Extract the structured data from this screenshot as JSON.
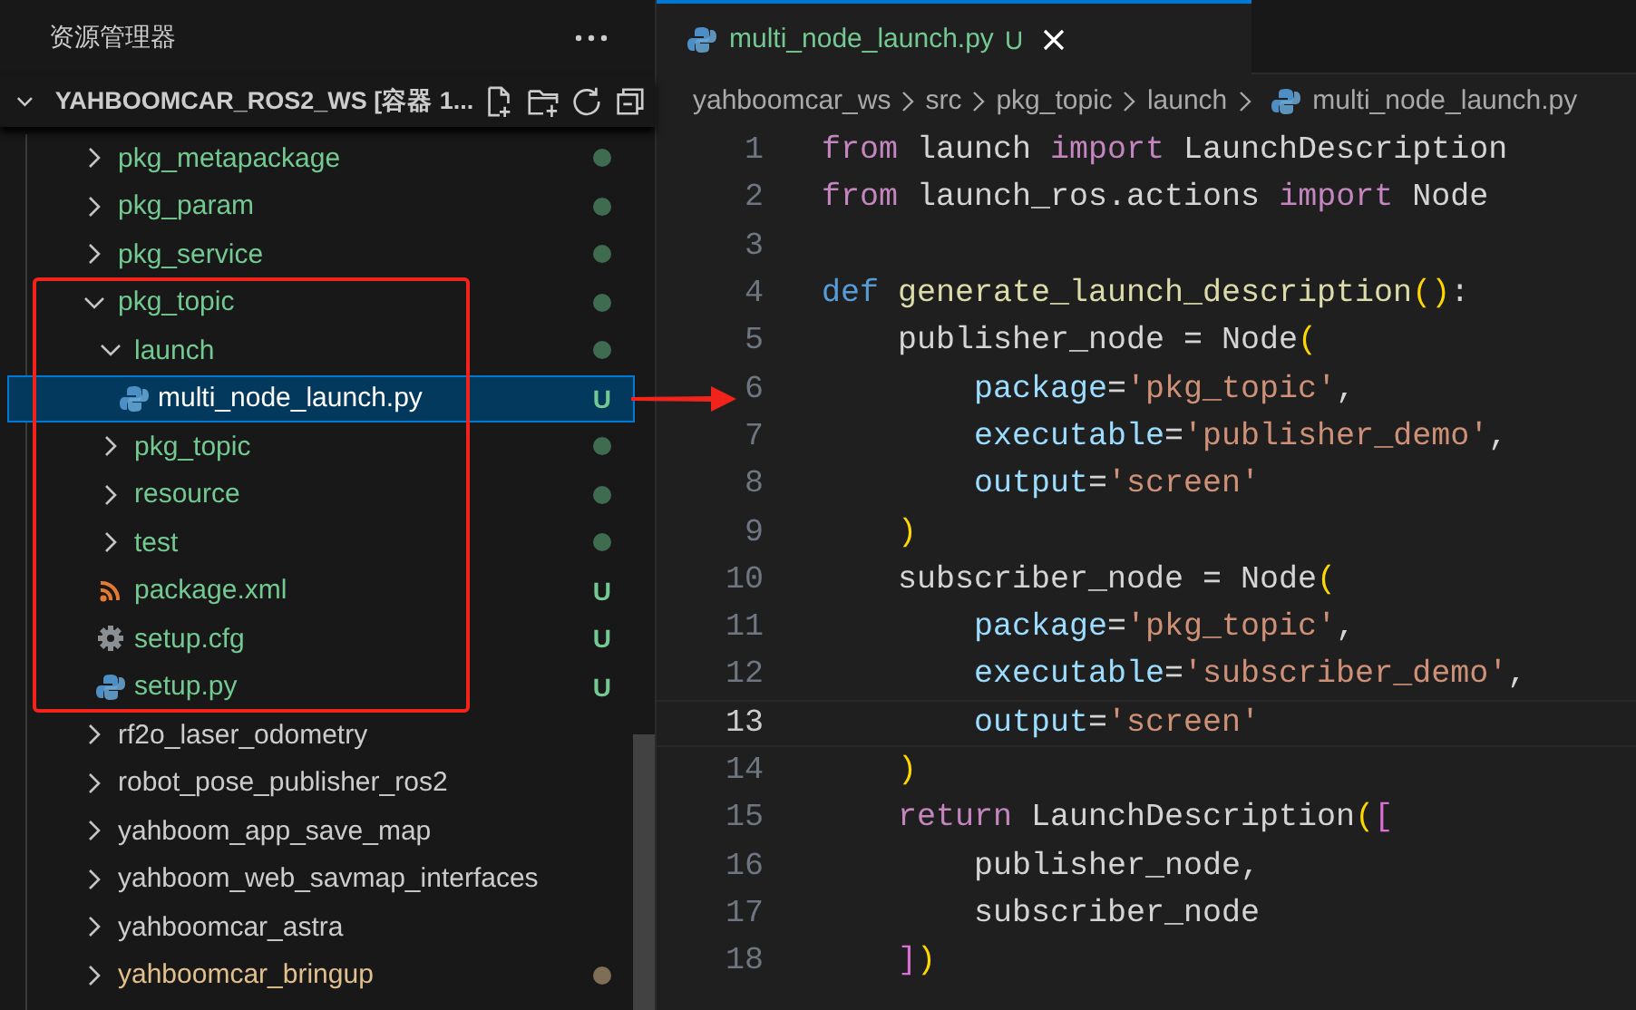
{
  "sidebar": {
    "title": "资源管理器",
    "section": {
      "title": "YAHBOOMCAR_ROS2_WS [容器 1...",
      "expanded": true
    },
    "tree": [
      {
        "label": "pkg_metapackage",
        "kind": "folder",
        "expanded": false,
        "selected": false,
        "untracked": true,
        "dot": true
      },
      {
        "label": "pkg_param",
        "kind": "folder",
        "expanded": false,
        "selected": false,
        "untracked": true,
        "dot": true
      },
      {
        "label": "pkg_service",
        "kind": "folder",
        "expanded": false,
        "selected": false,
        "untracked": true,
        "dot": true
      },
      {
        "label": "pkg_topic",
        "kind": "folder",
        "expanded": true,
        "selected": false,
        "untracked": true,
        "dot": true,
        "highlighted": true,
        "children": [
          {
            "label": "launch",
            "kind": "folder",
            "expanded": true,
            "selected": false,
            "untracked": true,
            "dot": true,
            "children": [
              {
                "label": "multi_node_launch.py",
                "kind": "python",
                "selected": true,
                "untracked": true,
                "badge": "U",
                "arrow": true
              }
            ]
          },
          {
            "label": "pkg_topic",
            "kind": "folder",
            "expanded": false,
            "selected": false,
            "untracked": true,
            "dot": true
          },
          {
            "label": "resource",
            "kind": "folder",
            "expanded": false,
            "selected": false,
            "untracked": true,
            "dot": true
          },
          {
            "label": "test",
            "kind": "folder",
            "expanded": false,
            "selected": false,
            "untracked": true,
            "dot": true
          },
          {
            "label": "package.xml",
            "kind": "xml",
            "selected": false,
            "untracked": true,
            "badge": "U"
          },
          {
            "label": "setup.cfg",
            "kind": "config",
            "selected": false,
            "untracked": true,
            "badge": "U"
          },
          {
            "label": "setup.py",
            "kind": "python",
            "selected": false,
            "untracked": true,
            "badge": "U"
          }
        ]
      },
      {
        "label": "rf2o_laser_odometry",
        "kind": "folder",
        "expanded": false,
        "selected": false
      },
      {
        "label": "robot_pose_publisher_ros2",
        "kind": "folder",
        "expanded": false,
        "selected": false
      },
      {
        "label": "yahboom_app_save_map",
        "kind": "folder",
        "expanded": false,
        "selected": false
      },
      {
        "label": "yahboom_web_savmap_interfaces",
        "kind": "folder",
        "expanded": false,
        "selected": false
      },
      {
        "label": "yahboomcar_astra",
        "kind": "folder",
        "expanded": false,
        "selected": false
      },
      {
        "label": "yahboomcar_bringup",
        "kind": "folder",
        "expanded": false,
        "selected": false,
        "modified": true,
        "dot": true
      }
    ]
  },
  "editor": {
    "tabs": [
      {
        "label": "multi_node_launch.py",
        "badge": "U",
        "kind": "python",
        "selected": true
      }
    ],
    "breadcrumbs": [
      {
        "label": "yahboomcar_ws",
        "kind": "folder"
      },
      {
        "label": "src",
        "kind": "folder"
      },
      {
        "label": "pkg_topic",
        "kind": "folder"
      },
      {
        "label": "launch",
        "kind": "folder"
      },
      {
        "label": "multi_node_launch.py",
        "kind": "python"
      }
    ],
    "lines": [
      {
        "number": "1",
        "current": false,
        "tokens": [
          {
            "kind": "keyword",
            "text": "from"
          },
          {
            "kind": "plain",
            "text": " launch "
          },
          {
            "kind": "keyword",
            "text": "import"
          },
          {
            "kind": "plain",
            "text": " LaunchDescription"
          }
        ]
      },
      {
        "number": "2",
        "current": false,
        "tokens": [
          {
            "kind": "keyword",
            "text": "from"
          },
          {
            "kind": "plain",
            "text": " launch_ros.actions "
          },
          {
            "kind": "keyword",
            "text": "import"
          },
          {
            "kind": "plain",
            "text": " Node"
          }
        ]
      },
      {
        "number": "3",
        "current": false
      },
      {
        "number": "4",
        "current": false,
        "tokens": [
          {
            "kind": "storage",
            "text": "def"
          },
          {
            "kind": "function",
            "text": " generate_launch_description"
          },
          {
            "kind": "bracket1",
            "text": "()"
          },
          {
            "kind": "plain",
            "text": ":"
          }
        ]
      },
      {
        "number": "5",
        "current": false,
        "tokens": [
          {
            "kind": "plain",
            "text": "    publisher_node = Node"
          },
          {
            "kind": "bracket1",
            "text": "("
          }
        ]
      },
      {
        "number": "6",
        "current": false,
        "tokens": [
          {
            "kind": "parameter",
            "text": "        package"
          },
          {
            "kind": "plain",
            "text": "="
          },
          {
            "kind": "string",
            "text": "'pkg_topic'"
          },
          {
            "kind": "plain",
            "text": ","
          }
        ]
      },
      {
        "number": "7",
        "current": false,
        "tokens": [
          {
            "kind": "parameter",
            "text": "        executable"
          },
          {
            "kind": "plain",
            "text": "="
          },
          {
            "kind": "string",
            "text": "'publisher_demo'"
          },
          {
            "kind": "plain",
            "text": ","
          }
        ]
      },
      {
        "number": "8",
        "current": false,
        "tokens": [
          {
            "kind": "parameter",
            "text": "        output"
          },
          {
            "kind": "plain",
            "text": "="
          },
          {
            "kind": "string",
            "text": "'screen'"
          }
        ]
      },
      {
        "number": "9",
        "current": false,
        "tokens": [
          {
            "kind": "bracket1",
            "text": "    )"
          }
        ]
      },
      {
        "number": "10",
        "current": false,
        "tokens": [
          {
            "kind": "plain",
            "text": "    subscriber_node = Node"
          },
          {
            "kind": "bracket1",
            "text": "("
          }
        ]
      },
      {
        "number": "11",
        "current": false,
        "tokens": [
          {
            "kind": "parameter",
            "text": "        package"
          },
          {
            "kind": "plain",
            "text": "="
          },
          {
            "kind": "string",
            "text": "'pkg_topic'"
          },
          {
            "kind": "plain",
            "text": ","
          }
        ]
      },
      {
        "number": "12",
        "current": false,
        "tokens": [
          {
            "kind": "parameter",
            "text": "        executable"
          },
          {
            "kind": "plain",
            "text": "="
          },
          {
            "kind": "string",
            "text": "'subscriber_demo'"
          },
          {
            "kind": "plain",
            "text": ","
          }
        ]
      },
      {
        "number": "13",
        "current": true,
        "tokens": [
          {
            "kind": "parameter",
            "text": "        output"
          },
          {
            "kind": "plain",
            "text": "="
          },
          {
            "kind": "string",
            "text": "'screen'"
          }
        ]
      },
      {
        "number": "14",
        "current": false,
        "tokens": [
          {
            "kind": "bracket1",
            "text": "    )"
          }
        ]
      },
      {
        "number": "15",
        "current": false,
        "tokens": [
          {
            "kind": "keyword",
            "text": "    return"
          },
          {
            "kind": "plain",
            "text": " LaunchDescription"
          },
          {
            "kind": "bracket1",
            "text": "("
          },
          {
            "kind": "bracket2",
            "text": "["
          }
        ]
      },
      {
        "number": "16",
        "current": false,
        "tokens": [
          {
            "kind": "plain",
            "text": "        publisher_node,"
          }
        ]
      },
      {
        "number": "17",
        "current": false,
        "tokens": [
          {
            "kind": "plain",
            "text": "        subscriber_node"
          }
        ]
      },
      {
        "number": "18",
        "current": false,
        "tokens": [
          {
            "kind": "bracket2",
            "text": "    ]"
          },
          {
            "kind": "bracket1",
            "text": ")"
          }
        ]
      }
    ]
  }
}
